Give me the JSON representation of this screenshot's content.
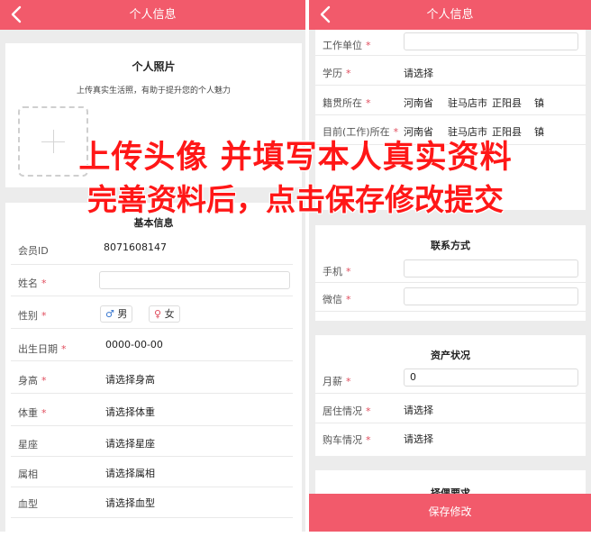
{
  "left_page": {
    "title": "个人信息",
    "photo": {
      "title": "个人照片",
      "subtitle": "上传真实生活照，有助于提升您的个人魅力"
    },
    "basic": {
      "title": "基本信息",
      "member_id": {
        "label": "会员ID",
        "value": "8071608147"
      },
      "name": {
        "label": "姓名",
        "value": ""
      },
      "gender": {
        "label": "性别",
        "male_symbol": "♂",
        "male": "男",
        "female_symbol": "♀",
        "female": "女"
      },
      "birthday": {
        "label": "出生日期",
        "value": "0000-00-00"
      },
      "height": {
        "label": "身高",
        "value": "请选择身高"
      },
      "weight": {
        "label": "体重",
        "value": "请选择体重"
      },
      "constellation": {
        "label": "星座",
        "value": "请选择星座"
      },
      "zodiac": {
        "label": "属相",
        "value": "请选择属相"
      },
      "blood": {
        "label": "血型",
        "value": "请选择血型"
      }
    },
    "required_mark": "*"
  },
  "right_page": {
    "title": "个人信息",
    "work_unit": {
      "label": "工作单位",
      "value": ""
    },
    "education": {
      "label": "学历",
      "value": "请选择"
    },
    "native": {
      "label": "籍贯所在",
      "province": "河南省",
      "city": "驻马店市",
      "county": "正阳县",
      "town": "镇"
    },
    "current": {
      "label": "目前(工作)所在",
      "province": "河南省",
      "city": "驻马店市",
      "county": "正阳县",
      "town": "镇"
    },
    "contact": {
      "title": "联系方式",
      "phone": {
        "label": "手机",
        "value": ""
      },
      "wechat": {
        "label": "微信",
        "value": ""
      }
    },
    "assets": {
      "title": "资产状况",
      "salary": {
        "label": "月薪",
        "value": "0"
      },
      "housing": {
        "label": "居住情况",
        "value": "请选择"
      },
      "car": {
        "label": "购车情况",
        "value": "请选择"
      }
    },
    "partner": {
      "title": "择偶要求"
    },
    "save_button": "保存修改"
  },
  "overlay": {
    "line1": "上传头像  并填写本人真实资料",
    "line2": "完善资料后，点击保存修改提交"
  },
  "colors": {
    "header": "#f25a6b",
    "overlay_text": "#ff1717",
    "required": "#e04c5d"
  },
  "icons": {
    "back": "chevron-left-icon",
    "upload": "plus-icon"
  }
}
